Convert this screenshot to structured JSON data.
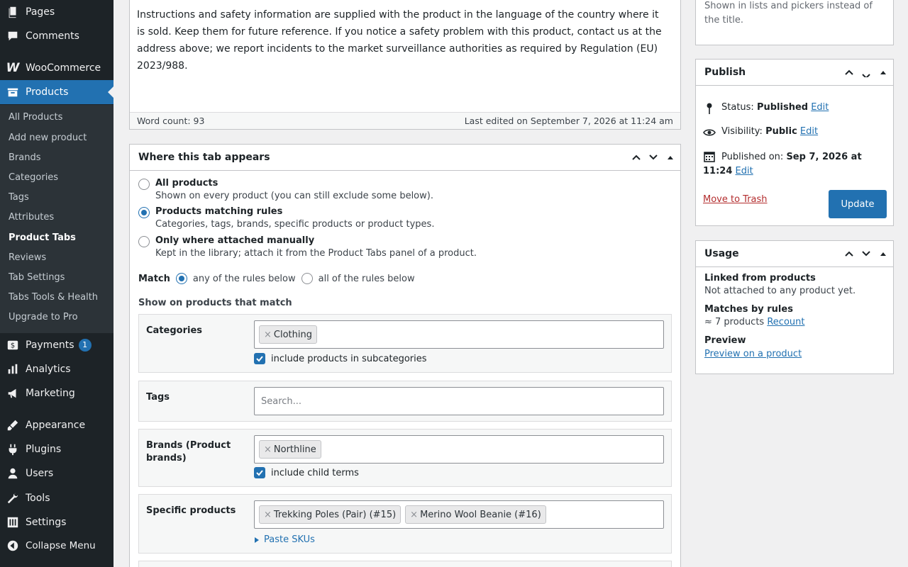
{
  "sidebar": {
    "top_items": [
      {
        "label": "Pages",
        "icon": "pages-icon"
      },
      {
        "label": "Comments",
        "icon": "comments-icon"
      },
      {
        "label": "WooCommerce",
        "icon": "woocommerce-icon"
      },
      {
        "label": "Products",
        "icon": "products-icon"
      }
    ],
    "submenu": [
      "All Products",
      "Add new product",
      "Brands",
      "Categories",
      "Tags",
      "Attributes",
      "Product Tabs",
      "Reviews",
      "Tab Settings",
      "Tabs Tools & Health",
      "Upgrade to Pro"
    ],
    "bottom_items": [
      {
        "label": "Payments",
        "icon": "payments-icon",
        "badge": "1"
      },
      {
        "label": "Analytics",
        "icon": "analytics-icon"
      },
      {
        "label": "Marketing",
        "icon": "marketing-icon"
      },
      {
        "label": "Appearance",
        "icon": "appearance-icon"
      },
      {
        "label": "Plugins",
        "icon": "plugins-icon"
      },
      {
        "label": "Users",
        "icon": "users-icon"
      },
      {
        "label": "Tools",
        "icon": "tools-icon"
      },
      {
        "label": "Settings",
        "icon": "settings-icon"
      },
      {
        "label": "Collapse Menu",
        "icon": "collapse-icon"
      }
    ]
  },
  "editor": {
    "content": "Instructions and safety information are supplied with the product in the language of the country where it is sold. Keep them for future reference. If you notice a safety problem with this product, contact us at the address above; we report incidents to the market surveillance authorities as required by Regulation (EU) 2023/988.",
    "word_count": "Word count: 93",
    "last_edited": "Last edited on September 7, 2026 at 11:24 am"
  },
  "where": {
    "title": "Where this tab appears",
    "options": [
      {
        "label": "All products",
        "desc": "Shown on every product (you can still exclude some below).",
        "selected": false
      },
      {
        "label": "Products matching rules",
        "desc": "Categories, tags, brands, specific products or product types.",
        "selected": true
      },
      {
        "label": "Only where attached manually",
        "desc": "Kept in the library; attach it from the Product Tabs panel of a product.",
        "selected": false
      }
    ],
    "match_label": "Match",
    "match_any": "any of the rules below",
    "match_all": "all of the rules below",
    "show_heading": "Show on products that match",
    "rules": {
      "categories": {
        "label": "Categories",
        "tokens": [
          "Clothing"
        ],
        "check": "include products in subcategories"
      },
      "tags": {
        "label": "Tags",
        "placeholder": "Search..."
      },
      "brands": {
        "label": "Brands (Product brands)",
        "tokens": [
          "Northline"
        ],
        "check": "include child terms"
      },
      "products": {
        "label": "Specific products",
        "tokens": [
          "Trekking Poles (Pair) (#15)",
          "Merino Wool Beanie (#16)"
        ],
        "link": "Paste SKUs"
      }
    }
  },
  "right": {
    "top_box_text": "Shown in lists and pickers instead of the title.",
    "publish": {
      "title": "Publish",
      "status_label": "Status:",
      "status_value": "Published",
      "visibility_label": "Visibility:",
      "visibility_value": "Public",
      "published_label": "Published on:",
      "published_value_a": "Sep 7, 2026 at",
      "published_value_b": "11:24",
      "edit": "Edit",
      "trash": "Move to Trash",
      "update": "Update"
    },
    "usage": {
      "title": "Usage",
      "linked_heading": "Linked from products",
      "linked_text": "Not attached to any product yet.",
      "matches_heading": "Matches by rules",
      "matches_text": "≈ 7 products",
      "recount": "Recount",
      "preview_heading": "Preview",
      "preview_link": "Preview on a product"
    }
  },
  "colors": {
    "accent": "#2271b1",
    "sidebar_bg": "#1d2327",
    "submenu_bg": "#2c3338",
    "trash": "#b32d2e"
  }
}
